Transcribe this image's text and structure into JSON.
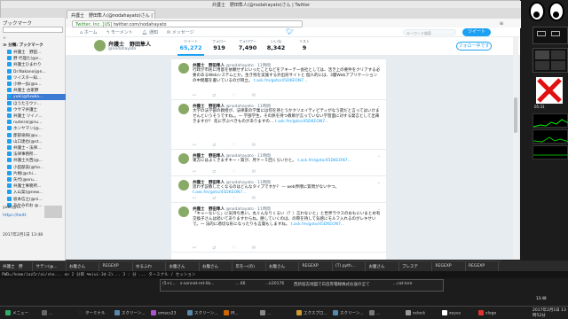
{
  "window": {
    "title": "弁護士　野田隼人(@nodahayato)さん | Twitter",
    "url": "twitter.com/nodahayato",
    "url_badge": "Twitter, Inc. [US]"
  },
  "sidebar": {
    "header": "ブックマーク",
    "toolbar_label": "☆",
    "section": "≫ 分類: ブックマーク",
    "items": [
      "弁護士　野田...",
      "野 代理た(@n...",
      "弁護士ひまわり",
      "Dr.Nakano(@n...",
      "ツイスター知...",
      "小林一弘(@a...",
      "弁護士 古家野",
      "yuki(@fuwko...",
      "ほうたろウソ...",
      "ウサマ弁護士",
      "弁護士 ツイノ...",
      "nuteira(@nu...",
      "ホンヤマン(@...",
      "郡部泉純(@u...",
      "山口達也(@st...",
      "弁護士・法律...",
      "法律事務所...",
      "弁護士大西(@...",
      "小田部美(@ho...",
      "片桐(@chi...",
      "矢代(@eru...",
      "弁護士事務所...",
      "入山案(@new...",
      "坂本信之(@ni...",
      "あやみのお @..."
    ],
    "info_name": "yuki(@fa...",
    "info_link": "https://twitt",
    "info_date": "2017年2月1日 13:48"
  },
  "twitter": {
    "nav": {
      "home": "ホーム",
      "moments": "モーメント",
      "notifications": "通知",
      "messages": "メッセージ"
    },
    "search_placeholder": "キーワード検索",
    "tweet_button": "ツイート",
    "profile": {
      "name": "弁護士　野田隼人",
      "handle": "@nodahayato",
      "stats": [
        {
          "label": "ツイート",
          "value": "65,272"
        },
        {
          "label": "フォロー",
          "value": "919"
        },
        {
          "label": "フォロワー",
          "value": "7,490"
        },
        {
          "label": "いいね",
          "value": "8,342"
        },
        {
          "label": "リスト",
          "value": "9"
        }
      ],
      "follow_button": "フォロー中です"
    },
    "tweets": [
      {
        "name": "弁護士　野田隼人",
        "handle": "@nodahayato · 11時間",
        "text": "行政が市民に用意を依頼せずにいったことなどをアキーテー会社としては、活き上の要件をクリアする必要のあるWebシステムとか。生き残を実施する外出形サイトと",
        "text2": "個人的には、3層Webアプリケーションの中間層を書いているのが目立。",
        "link": "t.ask.fm/goto/45DKEON7..."
      },
      {
        "name": "弁護士　野田隼人",
        "handle": "@nodahayato · 11時間",
        "text": "大学の法学部の教授が、法律家の学業には何を持とうかクリエイティビティがなう寂だと言ってはいけませんというそうですね。。ー 学部学生、その熱を持つ教師が言っていない学習面に対する発言として出来きますか？",
        "text2": "先に学ぶべきものがありますの…",
        "link": "t.ask.fm/goto/45DKEON7..."
      },
      {
        "name": "弁護士　野田隼人",
        "handle": "@nodahayato · 11時間",
        "text": "東方にはよくきますキー・質が、月ケー５回くらいかと。",
        "text2": "",
        "link": "t.ask.fm/goto/45DKEON7..."
      },
      {
        "name": "弁護士　野田隼人",
        "handle": "@nodahayato · 11時間",
        "text": "思わず説教したくなるのはどんなタイプですか？ — web界隈に質問がないやつ。",
        "text2": "",
        "link": "t.ask.fm/goto/45DKEON7..."
      },
      {
        "name": "弁護士　野田隼人",
        "handle": "@nodahayato · 11時間",
        "text": "「キャーないじ」に気持ち悪い。丸ぐんなりくるい（？）言わないと」と世界ラウスのおもにいまとめ有交換子さんは続いてありますからね。勝していくのは、の際を持して気感にモルフ入れるのがレキせいで。一 法的に適切な形になったりも言葉もしますね。",
        "text2": "",
        "link": "t.ask.fm/goto/45DKEON7..."
      }
    ]
  },
  "taskbar_top": [
    "弁護士　野",
    "サテン(@...",
    "お腹さん",
    "REGEXP",
    "ゆるふわ",
    "お腹さん",
    "お腹さん",
    "年を一(の)",
    "お腹さん",
    "REGEXP",
    "(T) pyth...",
    "お腹さん",
    "プレステ",
    "REGEXP",
    "REGEXP"
  ],
  "terminal": {
    "line": "PWD=/home/iaz5r/ai/sho... on 2  分目  %%(ui-3d-2)... 3 : 分 ... ターミナル / セッション",
    "tabs": [
      "(5+)...",
      "s-sonnet-ret-lib... ",
      "... 66",
      "...k20176",
      "西新宿志地図で白首券電線株式お送の全て",
      "...cat-lore"
    ]
  },
  "taskbar_bottom": [
    "メニュー",
    "...",
    "ターミナル",
    "スクリーン...",
    "emacs23",
    "スクリーン...",
    "IR...",
    "...",
    "エクスプロ...",
    "スクリーン...",
    "...",
    "xclock",
    "xeyes",
    "xlogo"
  ],
  "clock_bottom": "2017年2月1日 13時52分",
  "clock_right": "05:31",
  "clock_right2": "13:48",
  "colors": {
    "twitter_blue": "#1da1f2",
    "terminal_bg": "#141414"
  }
}
